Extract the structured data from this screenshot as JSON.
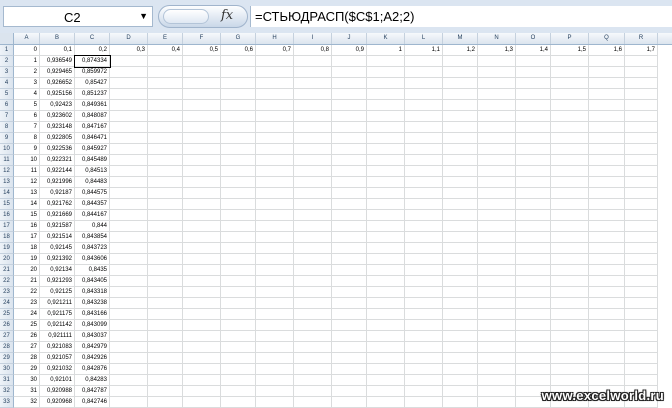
{
  "formula_bar": {
    "name_box": "C2",
    "fx_label": "fx",
    "formula": "=СТЬЮДРАСП($C$1;A2;2)"
  },
  "columns": [
    "A",
    "B",
    "C",
    "D",
    "E",
    "F",
    "G",
    "H",
    "I",
    "J",
    "K",
    "L",
    "M",
    "N",
    "O",
    "P",
    "Q",
    "R"
  ],
  "row_labels": [
    "1",
    "2",
    "3",
    "4",
    "5",
    "6",
    "7",
    "8",
    "9",
    "10",
    "11",
    "12",
    "13",
    "14",
    "15",
    "16",
    "17",
    "18",
    "19",
    "20",
    "21",
    "22",
    "23",
    "24",
    "25",
    "26",
    "27",
    "28",
    "29",
    "30",
    "31",
    "32",
    "33"
  ],
  "rows": [
    [
      "0",
      "0,1",
      "0,2",
      "0,3",
      "0,4",
      "0,5",
      "0,6",
      "0,7",
      "0,8",
      "0,9",
      "1",
      "1,1",
      "1,2",
      "1,3",
      "1,4",
      "1,5",
      "1,6",
      "1,7"
    ],
    [
      "1",
      "0,936549",
      "0,874334"
    ],
    [
      "2",
      "0,929465",
      "0,859972"
    ],
    [
      "3",
      "0,926652",
      "0,85427"
    ],
    [
      "4",
      "0,925156",
      "0,851237"
    ],
    [
      "5",
      "0,92423",
      "0,849361"
    ],
    [
      "6",
      "0,923602",
      "0,848087"
    ],
    [
      "7",
      "0,923148",
      "0,847167"
    ],
    [
      "8",
      "0,922805",
      "0,846471"
    ],
    [
      "9",
      "0,922536",
      "0,845927"
    ],
    [
      "10",
      "0,922321",
      "0,845489"
    ],
    [
      "11",
      "0,922144",
      "0,84513"
    ],
    [
      "12",
      "0,921996",
      "0,84483"
    ],
    [
      "13",
      "0,92187",
      "0,844575"
    ],
    [
      "14",
      "0,921762",
      "0,844357"
    ],
    [
      "15",
      "0,921669",
      "0,844167"
    ],
    [
      "16",
      "0,921587",
      "0,844"
    ],
    [
      "17",
      "0,921514",
      "0,843854"
    ],
    [
      "18",
      "0,92145",
      "0,843723"
    ],
    [
      "19",
      "0,921392",
      "0,843606"
    ],
    [
      "20",
      "0,92134",
      "0,8435"
    ],
    [
      "21",
      "0,921293",
      "0,843405"
    ],
    [
      "22",
      "0,92125",
      "0,843318"
    ],
    [
      "23",
      "0,921211",
      "0,843238"
    ],
    [
      "24",
      "0,921175",
      "0,843166"
    ],
    [
      "25",
      "0,921142",
      "0,843099"
    ],
    [
      "26",
      "0,921111",
      "0,843037"
    ],
    [
      "27",
      "0,921083",
      "0,842979"
    ],
    [
      "28",
      "0,921057",
      "0,842926"
    ],
    [
      "29",
      "0,921032",
      "0,842876"
    ],
    [
      "30",
      "0,92101",
      "0,84283"
    ],
    [
      "31",
      "0,920988",
      "0,842787"
    ],
    [
      "32",
      "0,920968",
      "0,842746"
    ]
  ],
  "selected_cell": "C2",
  "watermark": "www.excelworld.ru"
}
